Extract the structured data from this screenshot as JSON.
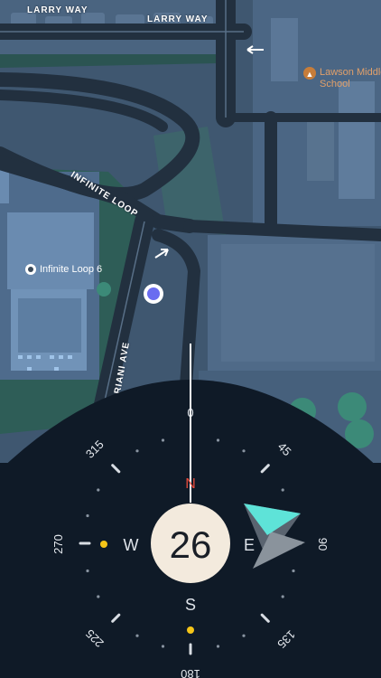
{
  "map": {
    "streets": {
      "larry_way_left": "LARRY WAY",
      "larry_way_right": "LARRY WAY",
      "infinite_loop": "INFINITE LOOP",
      "mariani_ave": "MARIANI AVE"
    },
    "pois": {
      "infinite_loop_6": "Infinite Loop 6",
      "school_line1": "Lawson Middle",
      "school_line2": "School"
    }
  },
  "compass": {
    "heading": "26",
    "cardinals": {
      "north": "N",
      "east": "E",
      "south": "S",
      "west": "W"
    },
    "degree_labels": {
      "d0": "0",
      "d45": "45",
      "d90": "90",
      "d135": "135",
      "d180": "180",
      "d225": "225",
      "d270": "270",
      "d315": "315"
    },
    "colors": {
      "panel": "#0f1a27",
      "dial": "#f3eadd",
      "north": "#e84b3c",
      "marker": "#f5c518",
      "arrow": "#5ee3d8"
    }
  }
}
